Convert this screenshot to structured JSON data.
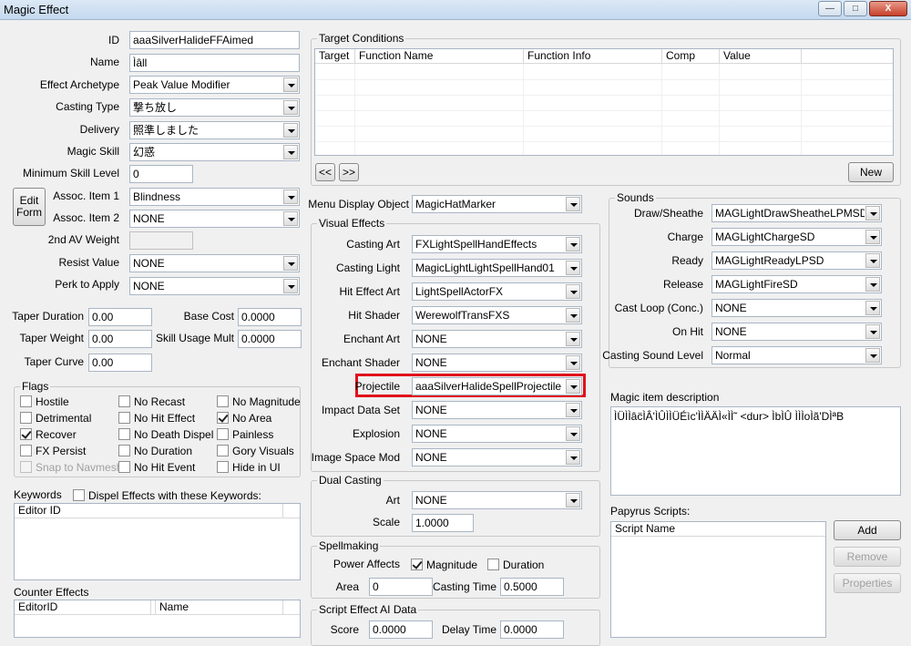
{
  "window": {
    "title": "Magic Effect",
    "min_glyph": "—",
    "max_glyph": "□",
    "close_glyph": "X"
  },
  "left": {
    "id_label": "ID",
    "id_value": "aaaSilverHalideFFAimed",
    "name_label": "Name",
    "name_value": "Ìâll",
    "archetype_label": "Effect Archetype",
    "archetype_value": "Peak Value Modifier",
    "casting_type_label": "Casting Type",
    "casting_type_value": "撃ち放し",
    "delivery_label": "Delivery",
    "delivery_value": "照準しました",
    "magic_skill_label": "Magic Skill",
    "magic_skill_value": "幻惑",
    "min_skill_label": "Minimum Skill Level",
    "min_skill_value": "0",
    "edit_form_label": "Edit Form",
    "assoc1_label": "Assoc. Item 1",
    "assoc1_value": "Blindness",
    "assoc2_label": "Assoc. Item 2",
    "assoc2_value": "NONE",
    "av_weight_label": "2nd AV Weight",
    "av_weight_value": "",
    "resist_label": "Resist Value",
    "resist_value": "NONE",
    "perk_label": "Perk to Apply",
    "perk_value": "NONE",
    "taper_duration_label": "Taper Duration",
    "taper_duration_value": "0.00",
    "base_cost_label": "Base Cost",
    "base_cost_value": "0.0000",
    "taper_weight_label": "Taper Weight",
    "taper_weight_value": "0.00",
    "skill_mult_label": "Skill Usage Mult",
    "skill_mult_value": "0.0000",
    "taper_curve_label": "Taper Curve",
    "taper_curve_value": "0.00"
  },
  "flags": {
    "title": "Flags",
    "items": [
      {
        "label": "Hostile",
        "checked": false,
        "disabled": false
      },
      {
        "label": "No Recast",
        "checked": false,
        "disabled": false
      },
      {
        "label": "No Magnitude",
        "checked": false,
        "disabled": false
      },
      {
        "label": "Detrimental",
        "checked": false,
        "disabled": false
      },
      {
        "label": "No Hit Effect",
        "checked": false,
        "disabled": false
      },
      {
        "label": "No Area",
        "checked": true,
        "disabled": false
      },
      {
        "label": "Recover",
        "checked": true,
        "disabled": false
      },
      {
        "label": "No Death Dispel",
        "checked": false,
        "disabled": false
      },
      {
        "label": "Painless",
        "checked": false,
        "disabled": false
      },
      {
        "label": "FX Persist",
        "checked": false,
        "disabled": false
      },
      {
        "label": "No Duration",
        "checked": false,
        "disabled": false
      },
      {
        "label": "Gory Visuals",
        "checked": false,
        "disabled": false
      },
      {
        "label": "Snap to Navmesh",
        "checked": false,
        "disabled": true
      },
      {
        "label": "No Hit Event",
        "checked": false,
        "disabled": false
      },
      {
        "label": "Hide in UI",
        "checked": false,
        "disabled": false
      }
    ]
  },
  "keywords": {
    "title": "Keywords",
    "dispel_label": "Dispel Effects with these Keywords:",
    "column": "Editor ID"
  },
  "counter": {
    "title": "Counter Effects",
    "col_editor": "EditorID",
    "col_name": "Name"
  },
  "target": {
    "title": "Target Conditions",
    "columns": [
      "Target",
      "Function Name",
      "Function Info",
      "Comp",
      "Value"
    ],
    "prev": "<<",
    "next": ">>",
    "new": "New"
  },
  "menu_display": {
    "label": "Menu Display Object",
    "value": "MagicHatMarker"
  },
  "visual": {
    "title": "Visual Effects",
    "casting_art_label": "Casting Art",
    "casting_art_value": "FXLightSpellHandEffects",
    "casting_light_label": "Casting Light",
    "casting_light_value": "MagicLightLightSpellHand01",
    "hit_art_label": "Hit Effect Art",
    "hit_art_value": "LightSpellActorFX",
    "hit_shader_label": "Hit Shader",
    "hit_shader_value": "WerewolfTransFXS",
    "enchant_art_label": "Enchant Art",
    "enchant_art_value": "NONE",
    "enchant_shader_label": "Enchant Shader",
    "enchant_shader_value": "NONE",
    "projectile_label": "Projectile",
    "projectile_value": "aaaSilverHalideSpellProjectile",
    "impact_label": "Impact Data Set",
    "impact_value": "NONE",
    "explosion_label": "Explosion",
    "explosion_value": "NONE",
    "image_space_label": "Image Space Mod",
    "image_space_value": "NONE"
  },
  "dual": {
    "title": "Dual Casting",
    "art_label": "Art",
    "art_value": "NONE",
    "scale_label": "Scale",
    "scale_value": "1.0000"
  },
  "spellmaking": {
    "title": "Spellmaking",
    "power_label": "Power Affects",
    "magnitude_label": "Magnitude",
    "magnitude_checked": true,
    "duration_label": "Duration",
    "duration_checked": false,
    "area_label": "Area",
    "area_value": "0",
    "casting_time_label": "Casting Time",
    "casting_time_value": "0.5000"
  },
  "ai": {
    "title": "Script Effect AI Data",
    "score_label": "Score",
    "score_value": "0.0000",
    "delay_label": "Delay Time",
    "delay_value": "0.0000"
  },
  "sounds": {
    "title": "Sounds",
    "draw_label": "Draw/Sheathe",
    "draw_value": "MAGLightDrawSheatheLPMSD",
    "charge_label": "Charge",
    "charge_value": "MAGLightChargeSD",
    "ready_label": "Ready",
    "ready_value": "MAGLightReadyLPSD",
    "release_label": "Release",
    "release_value": "MAGLightFireSD",
    "cast_loop_label": "Cast Loop (Conc.)",
    "cast_loop_value": "NONE",
    "on_hit_label": "On Hit",
    "on_hit_value": "NONE",
    "level_label": "Casting Sound Level",
    "level_value": "Normal"
  },
  "description": {
    "title": "Magic item description",
    "text": "ÌÜÌÌâc̈ÌÂ'ÌÛÌÌÜÉìc'ÌÌÄÄÌ«ÌÌ˜ <dur> ÌbÌÛ ÌÌÌoÌã'DÌªB"
  },
  "papyrus": {
    "title": "Papyrus Scripts:",
    "column": "Script Name",
    "add": "Add",
    "remove": "Remove",
    "properties": "Properties"
  }
}
